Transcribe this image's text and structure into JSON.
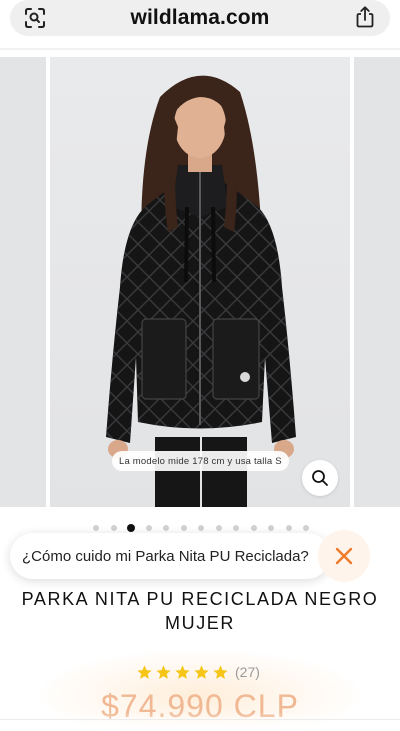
{
  "browser": {
    "url": "wildlama.com",
    "lens_icon": "camera-search-icon",
    "share_icon": "share-icon"
  },
  "gallery": {
    "model_note": "La modelo mide 178 cm y usa talla S",
    "zoom_icon": "magnifier-icon",
    "slide_count": 13,
    "active_index": 2
  },
  "chat": {
    "question": "¿Cómo cuido mi Parka Nita PU Reciclada?",
    "close_icon": "close-x-icon",
    "accent": "#f07a2a"
  },
  "product": {
    "title_line1": "PARKA NITA PU RECICLADA NEGRO",
    "title_line2": "MUJER",
    "rating_stars": 5,
    "rating_count": "(27)",
    "price": "$74.990 CLP",
    "star_color": "#f5c518",
    "price_color": "#f0b893"
  }
}
